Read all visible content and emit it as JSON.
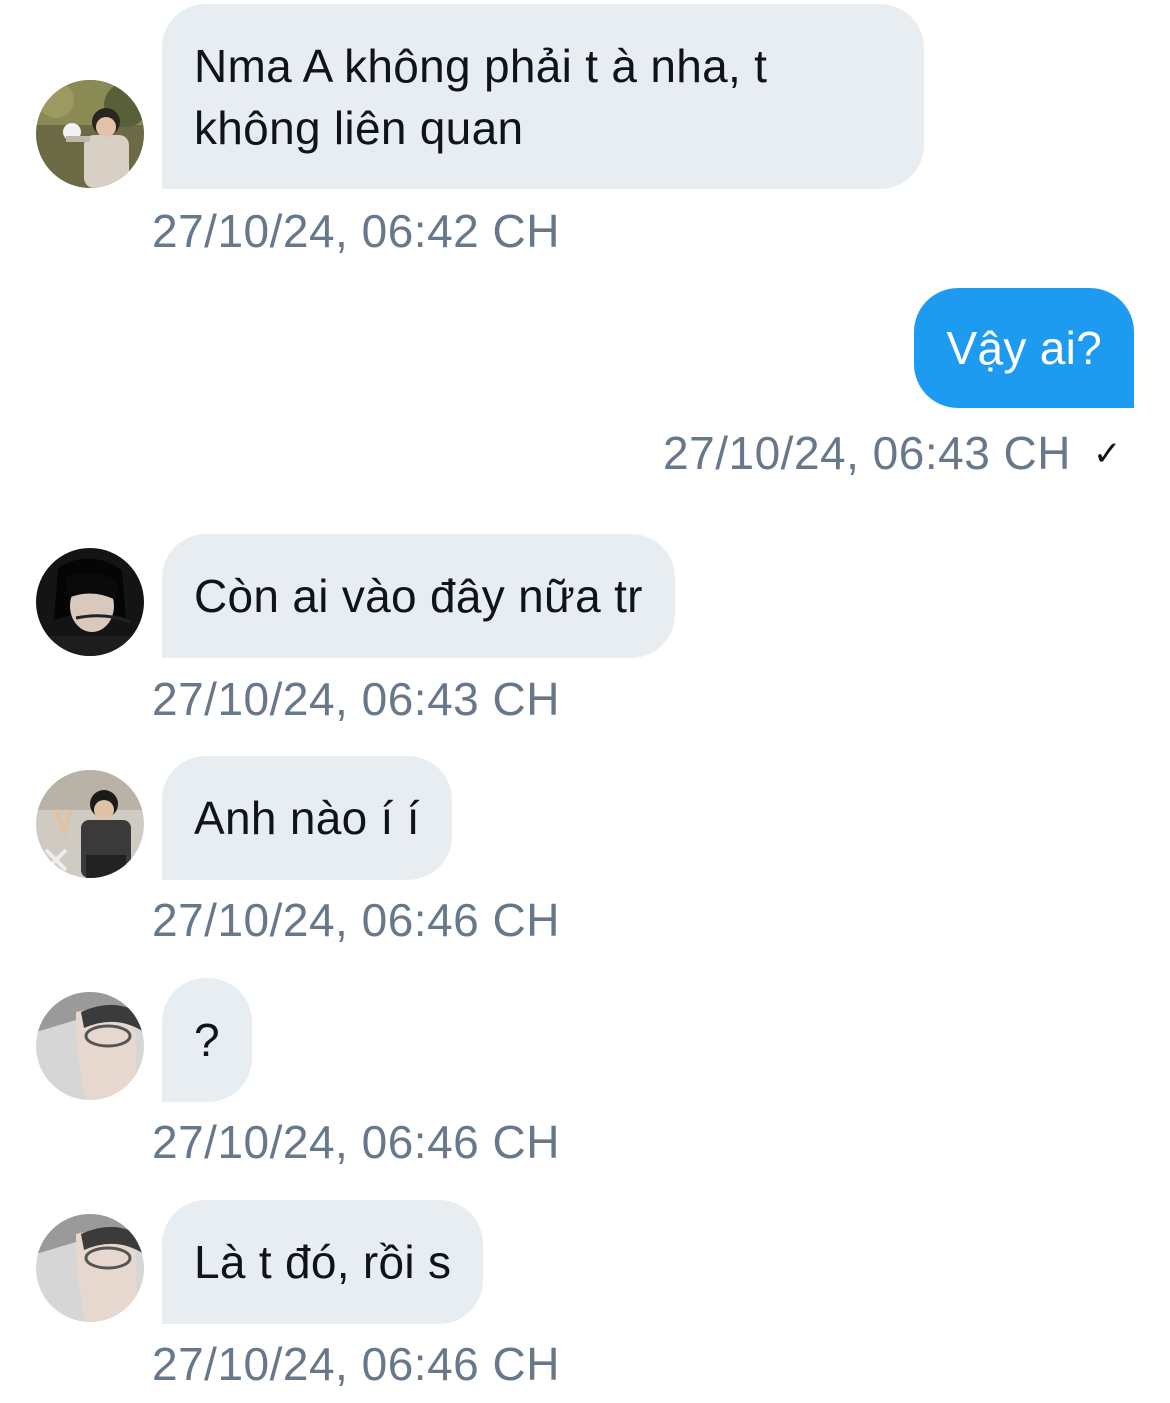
{
  "messages": [
    {
      "direction": "incoming",
      "avatar": "avatar-photo-1",
      "text": "Nma A không phải t à nha, t không liên quan",
      "timestamp": "27/10/24, 06:42 CH"
    },
    {
      "direction": "outgoing",
      "text": "Vậy ai?",
      "timestamp": "27/10/24, 06:43 CH",
      "status_icon": "check-icon",
      "status_glyph": "✓"
    },
    {
      "direction": "incoming",
      "avatar": "avatar-photo-2",
      "text": "Còn ai vào đây nữa tr",
      "timestamp": "27/10/24, 06:43 CH"
    },
    {
      "direction": "incoming",
      "avatar": "avatar-photo-3",
      "text": "Anh nào í í",
      "timestamp": "27/10/24, 06:46 CH"
    },
    {
      "direction": "incoming",
      "avatar": "avatar-photo-4",
      "text": "?",
      "timestamp": "27/10/24, 06:46 CH"
    },
    {
      "direction": "incoming",
      "avatar": "avatar-photo-4",
      "text": "Là t đó, rồi s",
      "timestamp": "27/10/24, 06:46 CH"
    }
  ],
  "colors": {
    "incoming_bubble": "#e8edf1",
    "outgoing_bubble": "#1d9bf0",
    "timestamp_text": "#66788a",
    "message_text": "#0f1419"
  }
}
